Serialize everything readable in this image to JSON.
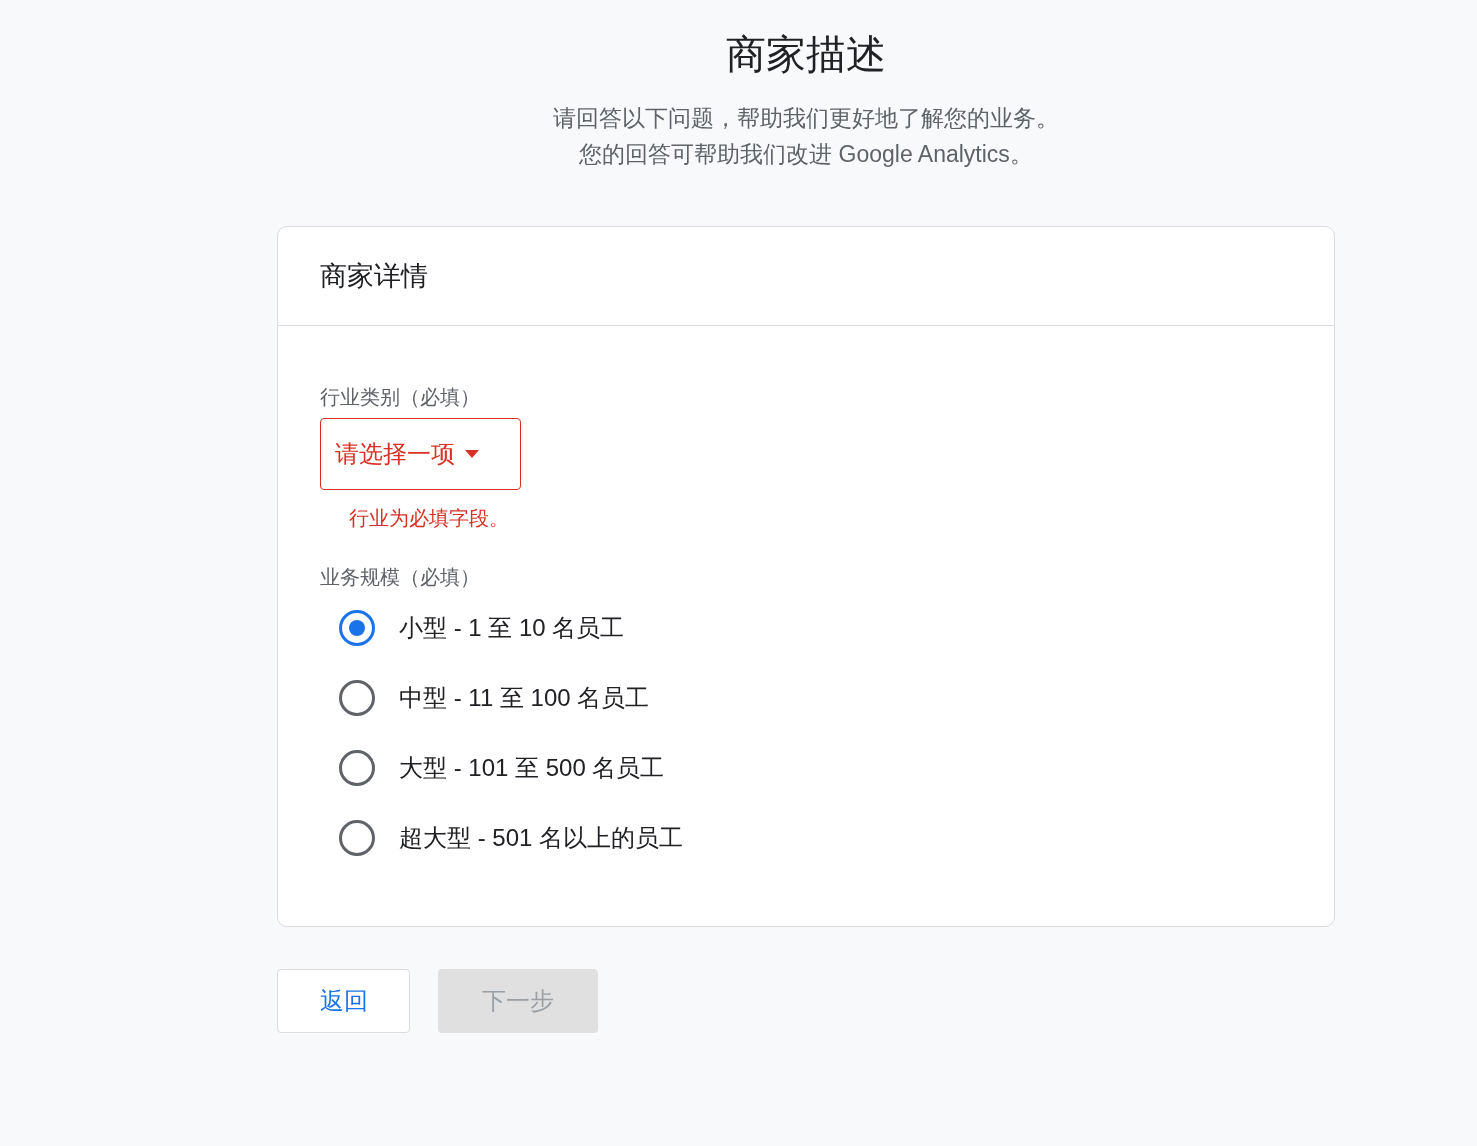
{
  "page": {
    "title": "商家描述",
    "subtitle_lines": [
      "请回答以下问题，帮助我们更好地了解您的业务。",
      "您的回答可帮助我们改进 Google Analytics。"
    ]
  },
  "card": {
    "title": "商家详情",
    "industry": {
      "label": "行业类别（必填）",
      "value": "请选择一项",
      "invalid": true,
      "error": "行业为必填字段。"
    },
    "size": {
      "label": "业务规模（必填）",
      "options": [
        {
          "label": "小型 - 1 至 10 名员工",
          "selected": true
        },
        {
          "label": "中型 - 11 至 100 名员工",
          "selected": false
        },
        {
          "label": "大型 - 101 至 500 名员工",
          "selected": false
        },
        {
          "label": "超大型 - 501 名以上的员工",
          "selected": false
        }
      ]
    }
  },
  "buttons": [
    {
      "label": "返回",
      "disabled": false
    },
    {
      "label": "下一步",
      "disabled": true
    }
  ]
}
